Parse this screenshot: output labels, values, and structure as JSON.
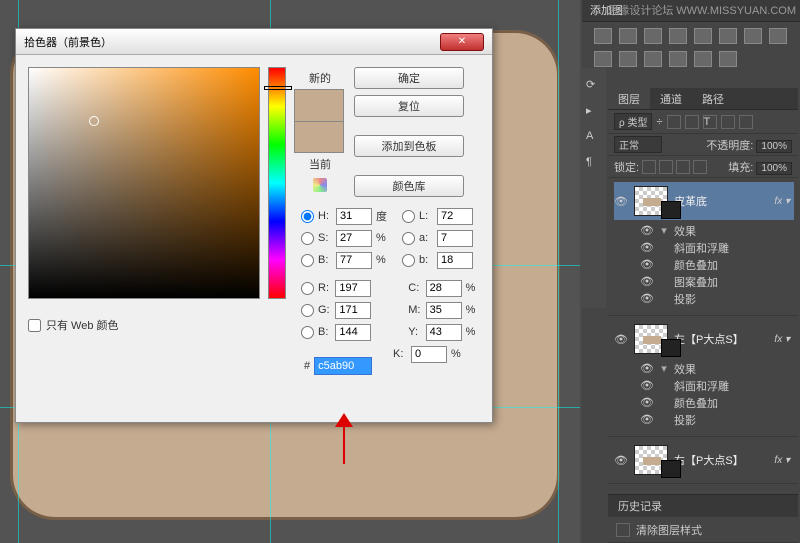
{
  "watermark": {
    "site": "思缘设计论坛",
    "url": "WWW.MISSYUAN.COM"
  },
  "canvas": {
    "guides_v": [
      18,
      270,
      558
    ],
    "guides_h": [
      265,
      407
    ]
  },
  "picker": {
    "title": "拾色器（前景色）",
    "close": "✕",
    "new_label": "新的",
    "cur_label": "当前",
    "buttons": {
      "ok": "确定",
      "reset": "复位",
      "add": "添加到色板",
      "lib": "颜色库"
    },
    "vals": {
      "H": "31",
      "S": "27",
      "B": "77",
      "L": "72",
      "a": "7",
      "b": "18",
      "R": "197",
      "G": "171",
      "Bv": "144",
      "C": "28",
      "M": "35",
      "Y": "43",
      "K": "0"
    },
    "degree": "度",
    "percent": "%",
    "hash": "#",
    "hex": "c5ab90",
    "webonly": "只有 Web 颜色"
  },
  "panel_add": "添加图",
  "layer_tabs": {
    "layers": "图层",
    "channels": "通道",
    "paths": "路径"
  },
  "layer_kind": "ρ 类型",
  "divider": "÷",
  "blend": "正常",
  "opacity_label": "不透明度:",
  "opacity_val": "100%",
  "lock_label": "锁定:",
  "fill_label": "填充:",
  "fill_val": "100%",
  "layers": [
    {
      "name": "皮革底",
      "selected": true,
      "fx": [
        "效果",
        "斜面和浮雕",
        "颜色叠加",
        "图案叠加",
        "投影"
      ]
    },
    {
      "name": "左【P大点S】",
      "selected": false,
      "fx": [
        "效果",
        "斜面和浮雕",
        "颜色叠加",
        "投影"
      ]
    },
    {
      "name": "右【P大点S】",
      "selected": false,
      "fx": []
    }
  ],
  "fx_label": "fx",
  "history": {
    "tab": "历史记录",
    "item": "清除图层样式"
  }
}
